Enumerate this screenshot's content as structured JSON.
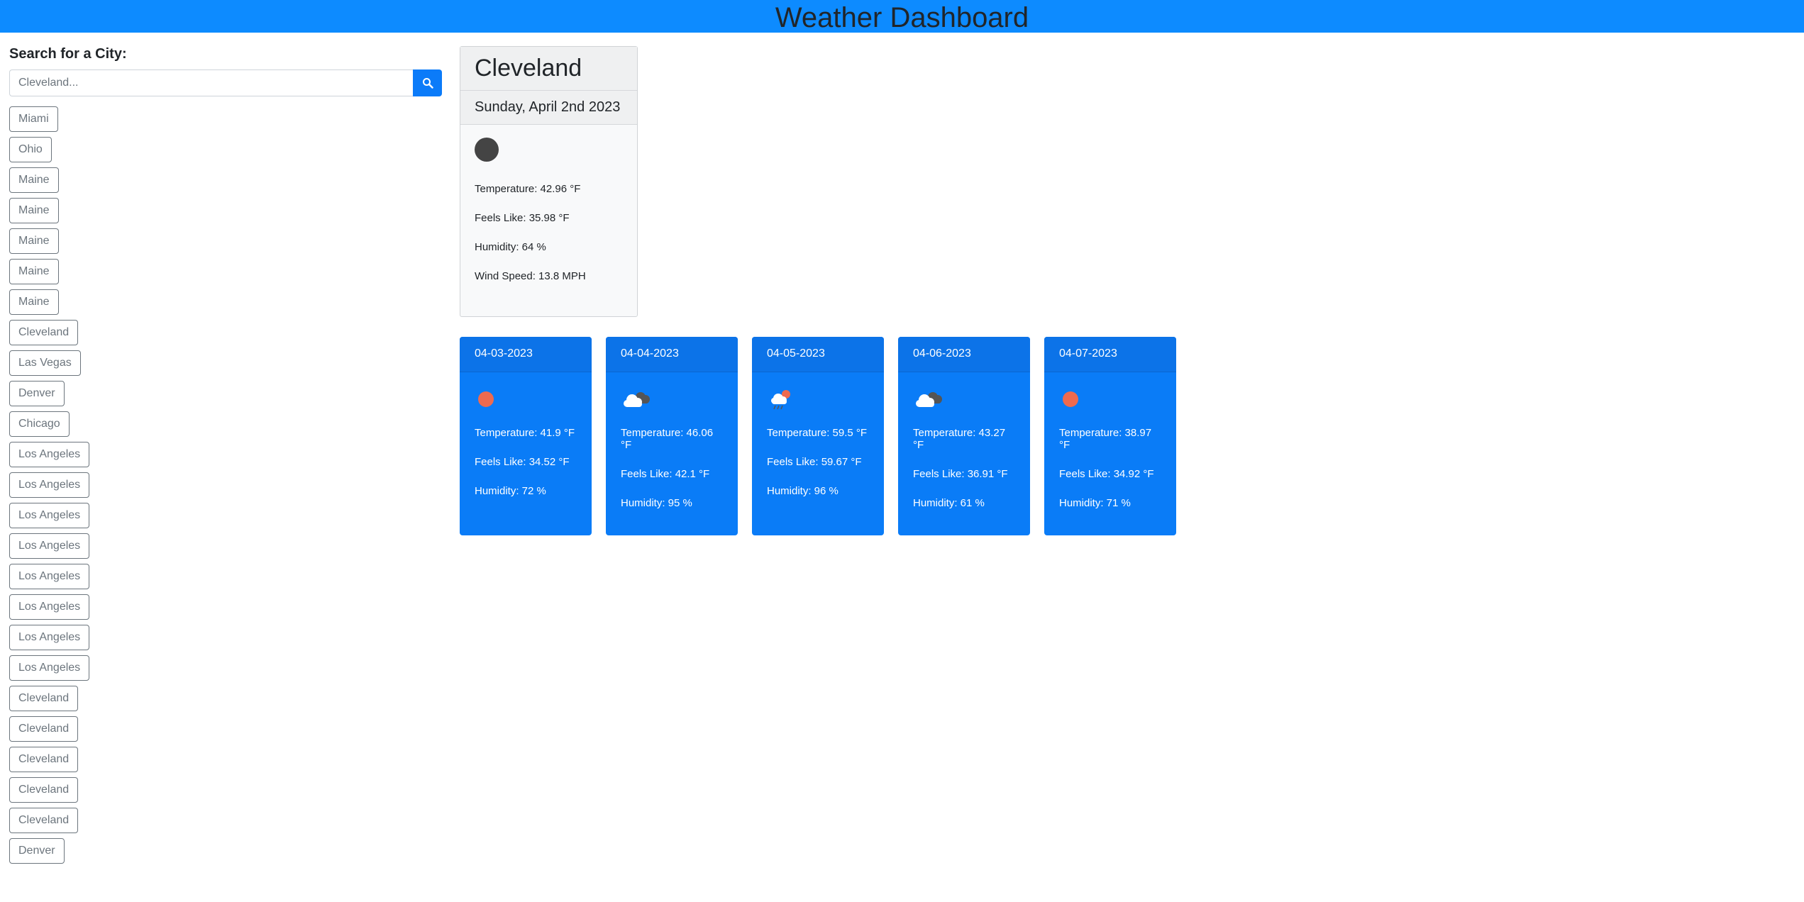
{
  "header": {
    "title": "Weather Dashboard"
  },
  "search": {
    "label": "Search for a City:",
    "placeholder": "Cleveland...",
    "button_icon": "search-icon"
  },
  "history": [
    "Miami",
    "Ohio",
    "Maine",
    "Maine",
    "Maine",
    "Maine",
    "Maine",
    "Cleveland",
    "Las Vegas",
    "Denver",
    "Chicago",
    "Los Angeles",
    "Los Angeles",
    "Los Angeles",
    "Los Angeles",
    "Los Angeles",
    "Los Angeles",
    "Los Angeles",
    "Los Angeles",
    "Cleveland",
    "Cleveland",
    "Cleveland",
    "Cleveland",
    "Cleveland",
    "Denver"
  ],
  "current": {
    "city": "Cleveland",
    "date": "Sunday, April 2nd 2023",
    "icon": "moon-icon",
    "temperature": "Temperature: 42.96 °F",
    "feels_like": "Feels Like: 35.98 °F",
    "humidity": "Humidity: 64 %",
    "wind": "Wind Speed: 13.8 MPH"
  },
  "forecast": [
    {
      "date": "04-03-2023",
      "icon": "sun-icon",
      "temperature": "Temperature: 41.9 °F",
      "feels_like": "Feels Like: 34.52 °F",
      "humidity": "Humidity: 72 %"
    },
    {
      "date": "04-04-2023",
      "icon": "broken-clouds-icon",
      "temperature": "Temperature: 46.06 °F",
      "feels_like": "Feels Like: 42.1 °F",
      "humidity": "Humidity: 95 %"
    },
    {
      "date": "04-05-2023",
      "icon": "rain-icon",
      "temperature": "Temperature: 59.5 °F",
      "feels_like": "Feels Like: 59.67 °F",
      "humidity": "Humidity: 96 %"
    },
    {
      "date": "04-06-2023",
      "icon": "broken-clouds-icon",
      "temperature": "Temperature: 43.27 °F",
      "feels_like": "Feels Like: 36.91 °F",
      "humidity": "Humidity: 61 %"
    },
    {
      "date": "04-07-2023",
      "icon": "sun-icon",
      "temperature": "Temperature: 38.97 °F",
      "feels_like": "Feels Like: 34.92 °F",
      "humidity": "Humidity: 71 %"
    }
  ],
  "colors": {
    "header": "#0d8bff",
    "card": "#0a7cf7",
    "button": "#0b7bf9",
    "sun": "#ee6a4f"
  }
}
